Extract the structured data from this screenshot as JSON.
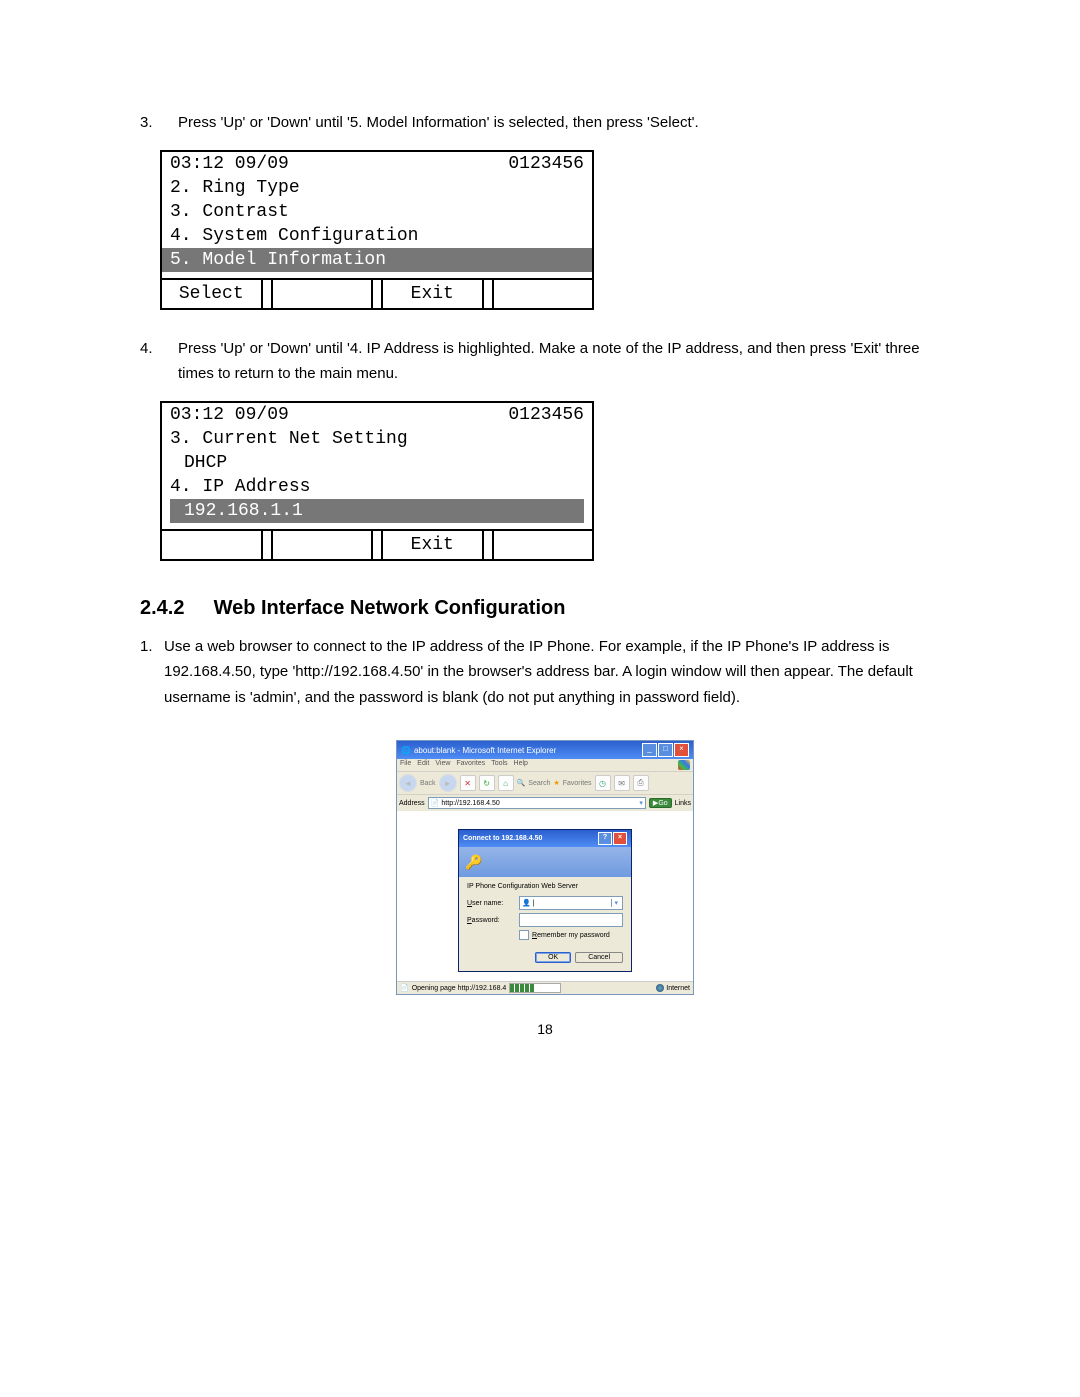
{
  "steps": {
    "s3": {
      "num": "3.",
      "text": "Press 'Up' or 'Down' until '5. Model Information' is selected, then press 'Select'."
    },
    "s4": {
      "num": "4.",
      "text": "Press 'Up' or 'Down' until '4. IP Address is highlighted.   Make a note of the IP address, and then press 'Exit' three times to return to the main menu."
    }
  },
  "lcd1": {
    "time": "03:12 09/09",
    "num": "0123456",
    "l2": "2. Ring Type",
    "l3": "3. Contrast",
    "l4": "4. System Configuration",
    "hl": "5. Model Information",
    "sk1": "Select",
    "sk3": "Exit"
  },
  "lcd2": {
    "time": "03:12 09/09",
    "num": "0123456",
    "l3": "3. Current Net Setting",
    "l3b": "DHCP",
    "l4": "4. IP Address",
    "hl": "192.168.1.1",
    "sk3": "Exit"
  },
  "section": {
    "num": "2.4.2",
    "title": "Web Interface Network Configuration"
  },
  "para1": {
    "num": "1.",
    "text": "Use a web browser to connect to the IP address of the IP Phone. For example, if the IP Phone's IP address is 192.168.4.50, type 'http://192.168.4.50' in the browser's address bar. A login window will then appear.   The default username is 'admin', and the password is blank (do not put anything in password field)."
  },
  "ie": {
    "title": "about:blank - Microsoft Internet Explorer",
    "menu": {
      "file": "File",
      "edit": "Edit",
      "view": "View",
      "fav": "Favorites",
      "tools": "Tools",
      "help": "Help"
    },
    "back": "Back",
    "search": "Search",
    "favorites": "Favorites",
    "addr_label": "Address",
    "addr_value": "http://192.168.4.50",
    "go": "Go",
    "links": "Links",
    "status_text": "Opening page http://192.168.4",
    "status_zone": "Internet"
  },
  "dlg": {
    "title": "Connect to 192.168.4.50",
    "realm": "IP Phone Configuration Web Server",
    "user_label": "User name:",
    "pass_label": "Password:",
    "remember": "Remember my password",
    "ok": "OK",
    "cancel": "Cancel"
  },
  "pagenum": "18"
}
